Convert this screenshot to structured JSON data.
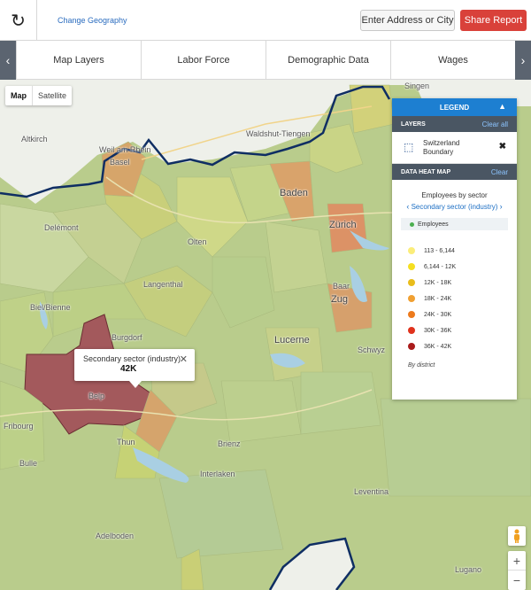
{
  "header": {
    "change_geography": "Change Geography",
    "address_button": "Enter Address or City",
    "share_button": "Share Report"
  },
  "tabs": [
    {
      "label": "Map Layers"
    },
    {
      "label": "Labor Force"
    },
    {
      "label": "Demographic Data"
    },
    {
      "label": "Wages"
    }
  ],
  "map": {
    "map_type": {
      "map": "Map",
      "satellite": "Satellite"
    },
    "places": {
      "singen": "Singen",
      "waldshut": "Waldshut-Tiengen",
      "altkirch": "Altkirch",
      "weil": "Weil am Rhein",
      "basel": "Basel",
      "delemont": "Delémont",
      "baden": "Baden",
      "zurich": "Zürich",
      "olten": "Olten",
      "langenthal": "Langenthal",
      "biel": "Biel/Bienne",
      "burgdorf": "Burgdorf",
      "baar": "Baar",
      "zug": "Zug",
      "lucerne": "Lucerne",
      "schwyz": "Schwyz",
      "belp": "Belp",
      "thun": "Thun",
      "fribourg": "Fribourg",
      "bulle": "Bulle",
      "brienz": "Brienz",
      "adelboden": "Adelboden",
      "lugano": "Lugano",
      "tessin": "Leventina",
      "interlaken": "Interlaken"
    },
    "tooltip": {
      "label": "Secondary sector (industry)",
      "value": "42K"
    }
  },
  "legend": {
    "title": "LEGEND",
    "layers_header": "LAYERS",
    "clear_all": "Clear all",
    "layer_name": "Switzerland Boundary",
    "heat_header": "DATA HEAT MAP",
    "clear": "Clear",
    "subtitle": "Employees by sector",
    "sector": "Secondary sector (industry)",
    "metric": "Employees",
    "scale": [
      {
        "label": "113 - 6,144",
        "color": "#fbed7a"
      },
      {
        "label": "6,144 - 12K",
        "color": "#f5df21"
      },
      {
        "label": "12K - 18K",
        "color": "#e9bd1b"
      },
      {
        "label": "18K - 24K",
        "color": "#f0a032"
      },
      {
        "label": "24K - 30K",
        "color": "#ed7a1c"
      },
      {
        "label": "30K - 36K",
        "color": "#e0321d"
      },
      {
        "label": "36K - 42K",
        "color": "#a91b1b"
      }
    ],
    "footer": "By district"
  }
}
